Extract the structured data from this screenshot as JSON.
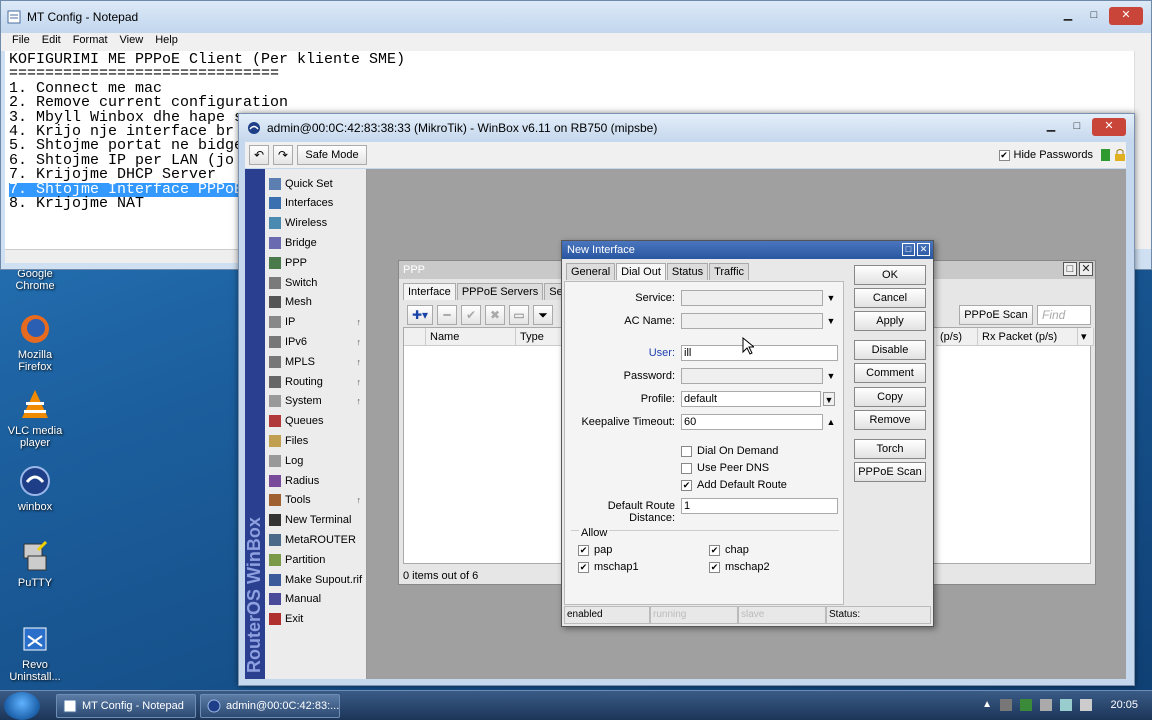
{
  "desktop": {
    "icons": [
      {
        "label": "Google\nChrome"
      },
      {
        "label": "Mozilla\nFirefox"
      },
      {
        "label": "VLC media\nplayer"
      },
      {
        "label": "winbox"
      },
      {
        "label": "PuTTY"
      },
      {
        "label": "Revo\nUninstall..."
      }
    ]
  },
  "notepad": {
    "title": "MT Config - Notepad",
    "menu": [
      "File",
      "Edit",
      "Format",
      "View",
      "Help"
    ],
    "lines": [
      "KOFIGURIMI ME PPPoE Client (Per kliente SME)",
      "==============================",
      "1. Connect me mac",
      "2. Remove current configuration",
      "3. Mbyll Winbox dhe hape s",
      "4. Krijo nje interface br",
      "5. Shtojme portat ne bidge",
      "6. Shtojme IP per LAN (jo",
      "7. Krijojme DHCP Server",
      "7. Shtojme Interface PPPoE",
      "8. Krijojme NAT"
    ],
    "selected_line": 9
  },
  "winbox": {
    "title": "admin@00:0C:42:83:38:33 (MikroTik) - WinBox v6.11 on RB750 (mipsbe)",
    "safe_mode": "Safe Mode",
    "hide_passwords": "Hide Passwords",
    "hide_passwords_checked": true,
    "brand": "RouterOS WinBox",
    "menu": [
      {
        "label": "Quick Set",
        "sub": false
      },
      {
        "label": "Interfaces",
        "sub": false
      },
      {
        "label": "Wireless",
        "sub": false
      },
      {
        "label": "Bridge",
        "sub": false
      },
      {
        "label": "PPP",
        "sub": false
      },
      {
        "label": "Switch",
        "sub": false
      },
      {
        "label": "Mesh",
        "sub": false
      },
      {
        "label": "IP",
        "sub": true
      },
      {
        "label": "IPv6",
        "sub": true
      },
      {
        "label": "MPLS",
        "sub": true
      },
      {
        "label": "Routing",
        "sub": true
      },
      {
        "label": "System",
        "sub": true
      },
      {
        "label": "Queues",
        "sub": false
      },
      {
        "label": "Files",
        "sub": false
      },
      {
        "label": "Log",
        "sub": false
      },
      {
        "label": "Radius",
        "sub": false
      },
      {
        "label": "Tools",
        "sub": true
      },
      {
        "label": "New Terminal",
        "sub": false
      },
      {
        "label": "MetaROUTER",
        "sub": false
      },
      {
        "label": "Partition",
        "sub": false
      },
      {
        "label": "Make Supout.rif",
        "sub": false
      },
      {
        "label": "Manual",
        "sub": false
      },
      {
        "label": "Exit",
        "sub": false
      }
    ]
  },
  "ppp": {
    "title": "PPP",
    "tabs": [
      "Interface",
      "PPPoE Servers",
      "Secret"
    ],
    "pppoe_scan": "PPPoE Scan",
    "find_placeholder": "Find",
    "columns": {
      "name": "Name",
      "type": "Type",
      "rx": "(p/s)",
      "rx_packet": "Rx Packet (p/s)"
    },
    "status": "0 items out of 6"
  },
  "dialog": {
    "title": "New Interface",
    "tabs": [
      "General",
      "Dial Out",
      "Status",
      "Traffic"
    ],
    "active_tab": "Dial Out",
    "fields": {
      "service_label": "Service:",
      "ac_name_label": "AC Name:",
      "user_label": "User:",
      "user_value": "ill",
      "password_label": "Password:",
      "profile_label": "Profile:",
      "profile_value": "default",
      "keepalive_label": "Keepalive Timeout:",
      "keepalive_value": "60",
      "default_route_distance_label": "Default Route Distance:",
      "default_route_distance_value": "1"
    },
    "checkboxes": {
      "dial_on_demand": {
        "label": "Dial On Demand",
        "checked": false
      },
      "use_peer_dns": {
        "label": "Use Peer DNS",
        "checked": false
      },
      "add_default_route": {
        "label": "Add Default Route",
        "checked": true
      }
    },
    "allow": {
      "title": "Allow",
      "pap": {
        "label": "pap",
        "checked": true
      },
      "chap": {
        "label": "chap",
        "checked": true
      },
      "mschap1": {
        "label": "mschap1",
        "checked": true
      },
      "mschap2": {
        "label": "mschap2",
        "checked": true
      }
    },
    "buttons": [
      "OK",
      "Cancel",
      "Apply",
      "Disable",
      "Comment",
      "Copy",
      "Remove",
      "Torch",
      "PPPoE Scan"
    ],
    "status_bar": [
      "enabled",
      "running",
      "slave",
      "Status:"
    ]
  },
  "taskbar": {
    "items": [
      "MT Config - Notepad",
      "admin@00:0C:42:83:..."
    ],
    "clock": "20:05"
  },
  "colors": {
    "accent": "#2a55a0",
    "selection": "#3399ff",
    "winbox_brand": "#2a3f8f"
  }
}
